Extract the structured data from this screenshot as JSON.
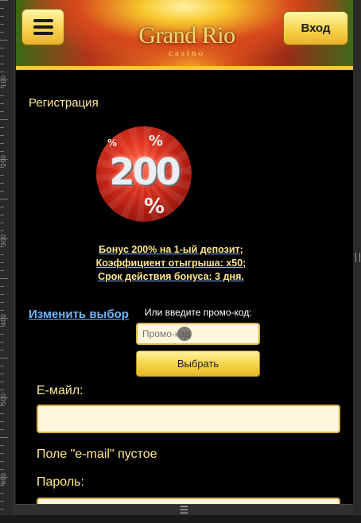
{
  "header": {
    "logo_main": "Grand Rio",
    "logo_sub": "casino",
    "menu_icon": "hamburger-icon",
    "login_label": "Вход"
  },
  "registration": {
    "title": "Регистрация",
    "bonus_badge": {
      "value": "200",
      "percent_sign": "%"
    },
    "bonus_lines": [
      "Бонус 200% на 1-ый депозит;",
      "Коэффициент отыгрыша: x50;",
      "Срок действия бонуса: 3 дня."
    ],
    "change_choice_link": "Изменить выбор",
    "promo": {
      "label": "Или введите промо-код:",
      "placeholder": "Промо-код",
      "button_label": "Выбрать"
    }
  },
  "form": {
    "email_label": "Е-майл:",
    "email_value": "",
    "email_error": "Поле \"e-mail\" пустое",
    "password_label": "Пароль:",
    "password_value": ""
  },
  "devtools": {
    "ruler_marks": [
      "100",
      "200",
      "300",
      "400",
      "500",
      "600"
    ],
    "bottom_handle_icon": "drag-handle-icon",
    "bottom_handle_glyph": "☰"
  },
  "colors": {
    "background": "#000000",
    "accent_yellow": "#f7d34b",
    "label_yellow": "#ffe98a",
    "link_blue": "#6fb5ff",
    "input_bg": "#fff6dc"
  }
}
